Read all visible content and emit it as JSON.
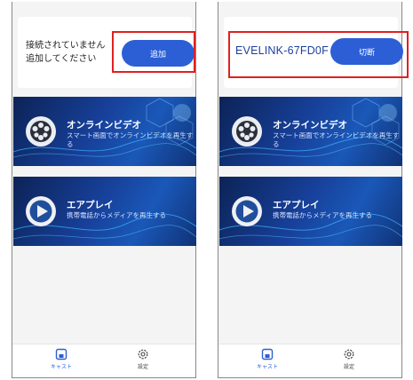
{
  "left_screen": {
    "connection": {
      "message_line1": "接続されていません",
      "message_line2": "追加してください",
      "button_label": "追加"
    }
  },
  "right_screen": {
    "connection": {
      "device_name": "EVELINK-67FD0F",
      "button_label": "切断"
    }
  },
  "banners": [
    {
      "title": "オンラインビデオ",
      "description": "スマート画面でオンラインビデオを再生する",
      "icon": "film-reel-icon"
    },
    {
      "title": "エアプレイ",
      "description": "携帯電話からメディアを再生する",
      "icon": "play-icon"
    }
  ],
  "tabbar": {
    "cast_label": "キャスト",
    "settings_label": "設定"
  },
  "colors": {
    "accent": "#2c5fd6",
    "highlight": "#e02020",
    "banner_dark": "#0c2356"
  }
}
